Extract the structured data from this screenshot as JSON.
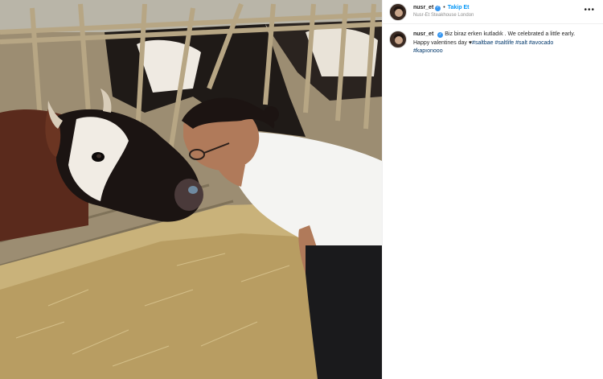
{
  "post": {
    "username": "nusr_et",
    "follow_label": "Takip Et",
    "separator": "•",
    "location": "Nusr-Et Steakhouse London",
    "more_label": "•••",
    "caption": {
      "username": "nusr_et",
      "line1": "Biz biraz erken kutladık . We celebrated a little early.",
      "line2": "Happy valentines day ",
      "heart": "♥",
      "hashtags": [
        "#saltbae",
        "#saltlife",
        "#salt",
        "#avocado",
        "#kapıonooo"
      ]
    }
  },
  "icons": {
    "verified": "verified-badge-icon",
    "more": "more-options-icon"
  },
  "colors": {
    "link_blue": "#0095f6",
    "hashtag": "#00376b",
    "verified": "#3897f0",
    "secondary_text": "#8e8e8e"
  }
}
